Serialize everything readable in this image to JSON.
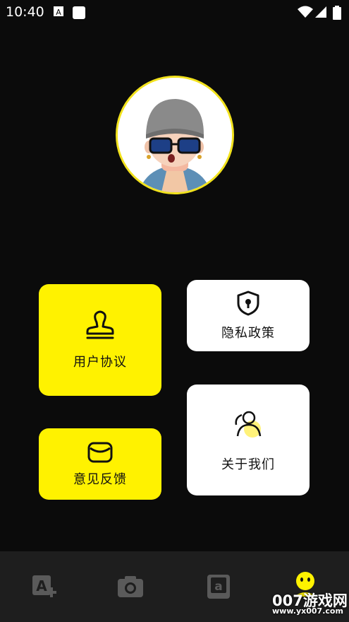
{
  "status": {
    "time": "10:40"
  },
  "cards": {
    "user_agreement": "用户协议",
    "privacy_policy": "隐私政策",
    "feedback": "意见反馈",
    "about_us": "关于我们"
  },
  "watermark": "007游戏网 www.yx007.com",
  "watermark_main": "007游戏网",
  "watermark_url": "www.yx007.com",
  "colors": {
    "accent": "#fff200",
    "background": "#0b0b0b",
    "tabbar": "#1e1e1e"
  },
  "icons": {
    "status": [
      "text-a-icon",
      "square-icon",
      "wifi-icon",
      "signal-icon",
      "battery-icon"
    ],
    "tabs": [
      "font-add-icon",
      "camera-icon",
      "address-book-icon",
      "smiley-profile-icon"
    ]
  }
}
